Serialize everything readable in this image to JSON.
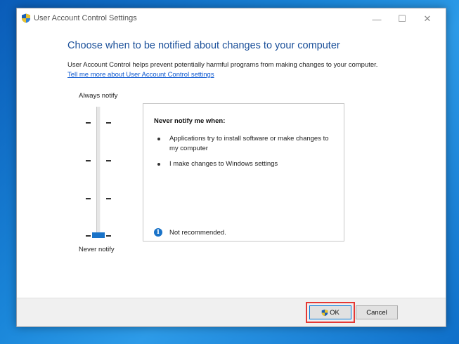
{
  "window": {
    "title": "User Account Control Settings",
    "minimize_glyph": "—",
    "maximize_glyph": "☐",
    "close_glyph": "✕"
  },
  "content": {
    "heading": "Choose when to be notified about changes to your computer",
    "description": "User Account Control helps prevent potentially harmful programs from making changes to your computer.",
    "link": "Tell me more about User Account Control settings"
  },
  "slider": {
    "top_label": "Always notify",
    "bottom_label": "Never notify",
    "levels": 4,
    "selected_level": 1
  },
  "panel": {
    "title": "Never notify me when:",
    "bullets": [
      "Applications try to install software or make changes to my computer",
      "I make changes to Windows settings"
    ],
    "info_glyph": "i",
    "info_text": "Not recommended."
  },
  "buttons": {
    "ok": "OK",
    "cancel": "Cancel"
  },
  "icons": {
    "title_icon": "uac-shield-icon",
    "ok_icon": "uac-shield-icon"
  },
  "colors": {
    "heading": "#1a4f99",
    "link": "#0b57d0",
    "thumb": "#1a73c8",
    "highlight": "#e53935"
  }
}
